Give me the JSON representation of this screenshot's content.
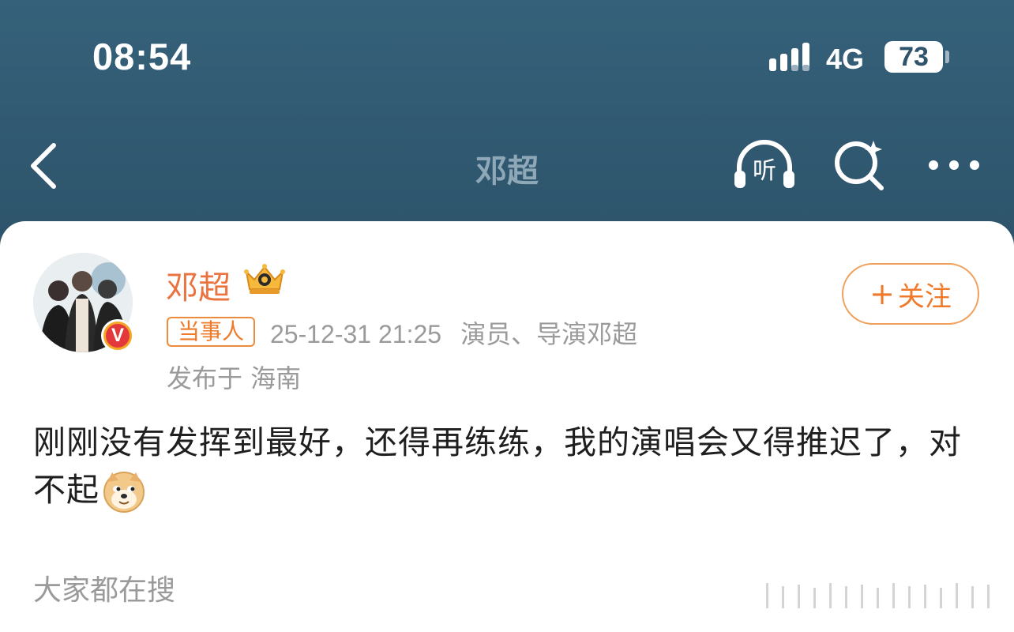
{
  "status_bar": {
    "time": "08:54",
    "network": "4G",
    "battery": "73"
  },
  "nav": {
    "title": "邓超",
    "listen_label": "听"
  },
  "post": {
    "username": "邓超",
    "follow_label": "关注",
    "tag": "当事人",
    "time": "25-12-31 21:25",
    "verification": "演员、导演邓超",
    "location": "发布于 海南",
    "content": "刚刚没有发挥到最好，还得再练练，我的演唱会又得推迟了，对不起",
    "emoji": "doge-emoji"
  },
  "trending_label": "大家都在搜",
  "colors": {
    "header_bg": "#2f536a",
    "username": "#eb7340",
    "follow": "#ef7a2a",
    "meta": "#9a9a9a"
  }
}
